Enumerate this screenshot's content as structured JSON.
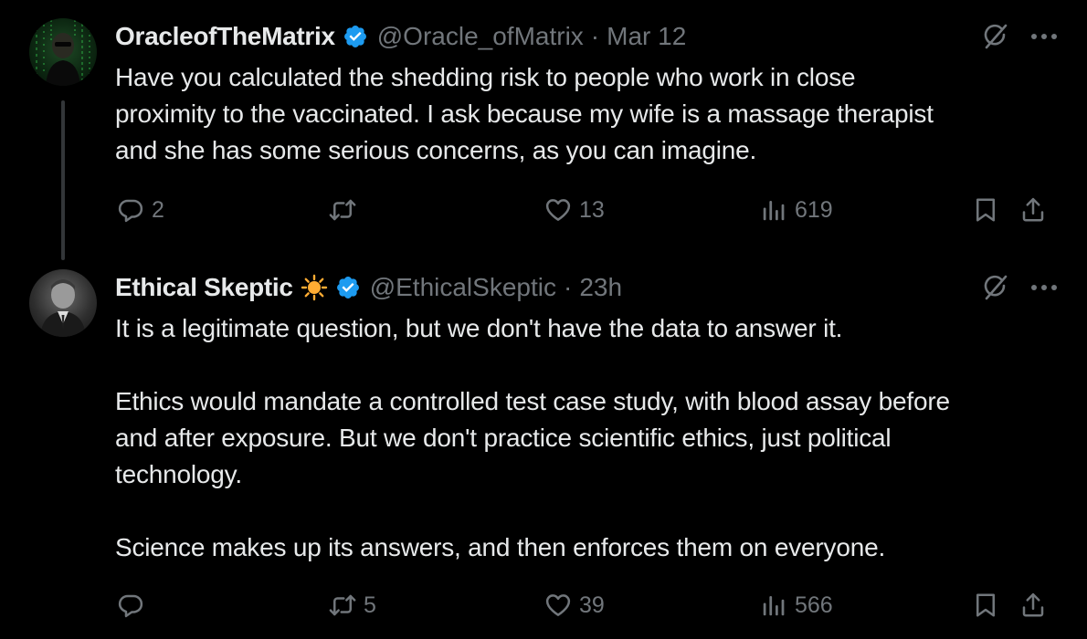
{
  "tweets": [
    {
      "name": "OracleofTheMatrix",
      "handle": "@Oracle_ofMatrix",
      "separator": "·",
      "time": "Mar 12",
      "text": "Have you calculated the shedding risk to people who work in close\nproximity to the vaccinated. I ask because my wife is a massage therapist\nand she has some serious concerns, as you can imagine.",
      "replies": "2",
      "retweets": "",
      "likes": "13",
      "views": "619"
    },
    {
      "name": "Ethical Skeptic",
      "handle": "@EthicalSkeptic",
      "separator": "·",
      "time": "23h",
      "text": "It is a legitimate question, but we don't have the data to answer it.\n\nEthics would mandate a controlled test case study, with blood assay before\nand after exposure. But we don't practice scientific ethics, just political\ntechnology.\n\nScience makes up its answers, and then enforces them on everyone.",
      "replies": "",
      "retweets": "5",
      "likes": "39",
      "views": "566"
    }
  ],
  "icons": {
    "verified": "verified-badge-icon",
    "sun": "sun-emoji-icon",
    "grok": "grok-icon",
    "more": "more-icon",
    "reply": "reply-icon",
    "retweet": "retweet-icon",
    "like": "heart-icon",
    "views": "views-icon",
    "bookmark": "bookmark-icon",
    "share": "share-icon"
  },
  "colors": {
    "background": "#000000",
    "text": "#e7e9ea",
    "muted": "#71767b",
    "verified": "#1d9bf0",
    "sun": "#ffac33"
  }
}
